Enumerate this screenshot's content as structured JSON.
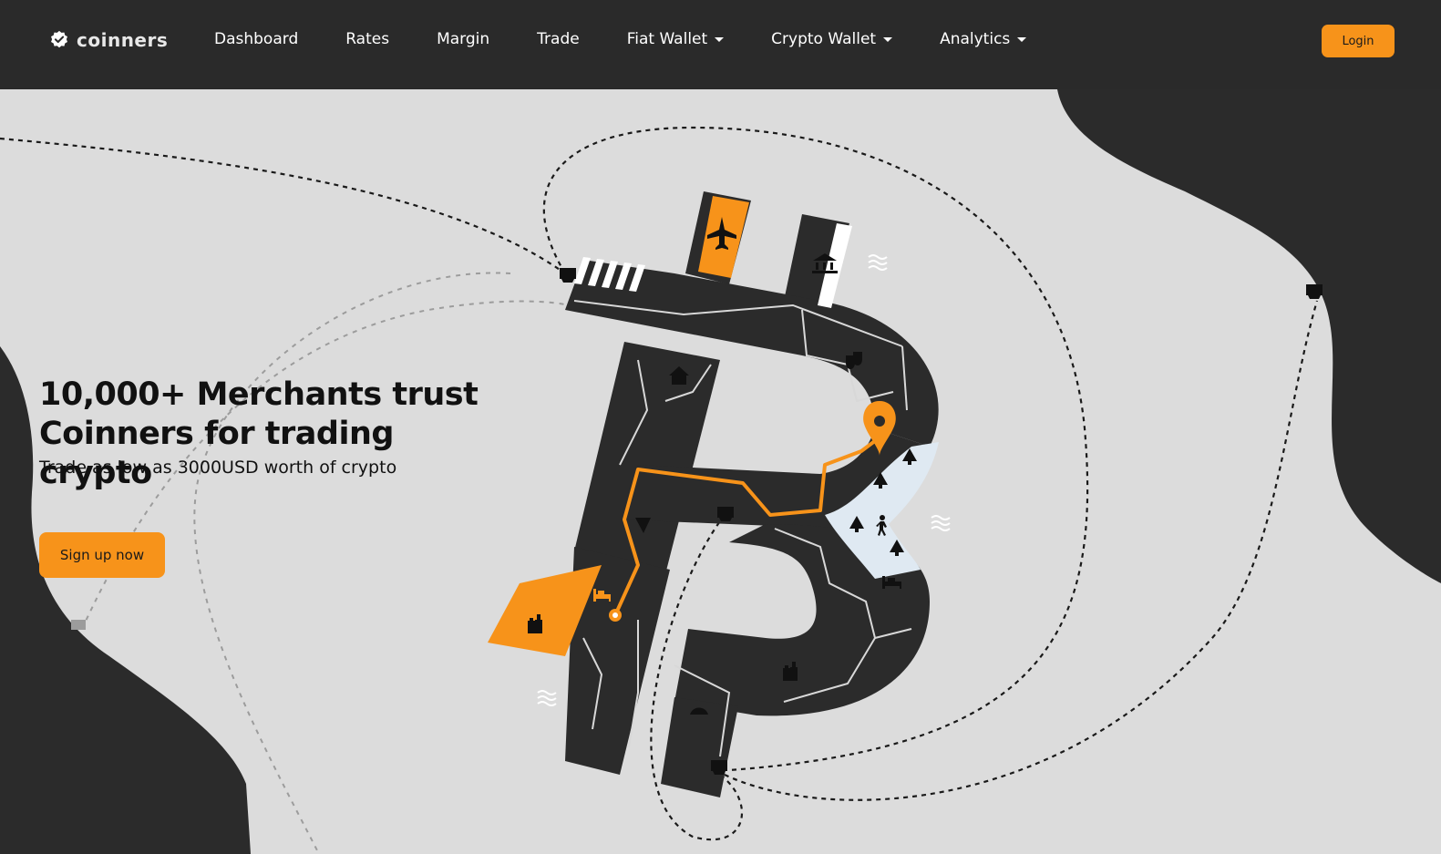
{
  "brand": {
    "name": "coinners",
    "icon": "check-badge-icon"
  },
  "nav": {
    "items": [
      {
        "label": "Dashboard",
        "dropdown": false
      },
      {
        "label": "Rates",
        "dropdown": false
      },
      {
        "label": "Margin",
        "dropdown": false
      },
      {
        "label": "Trade",
        "dropdown": false
      },
      {
        "label": "Fiat Wallet",
        "dropdown": true
      },
      {
        "label": "Crypto Wallet",
        "dropdown": true
      },
      {
        "label": "Analytics",
        "dropdown": true
      }
    ],
    "login_label": "Login"
  },
  "hero": {
    "headline": "10,000+ Merchants trust Coinners for trading crypto",
    "subline": "Trade as low as 3000USD worth of crypto",
    "cta_label": "Sign up now",
    "illustration": "bitcoin-city-map-illustration"
  },
  "colors": {
    "navbar_bg": "#2a2a2a",
    "accent": "#f7931a",
    "hero_bg": "#dcdcdc",
    "dark_shape": "#2b2b2b"
  }
}
